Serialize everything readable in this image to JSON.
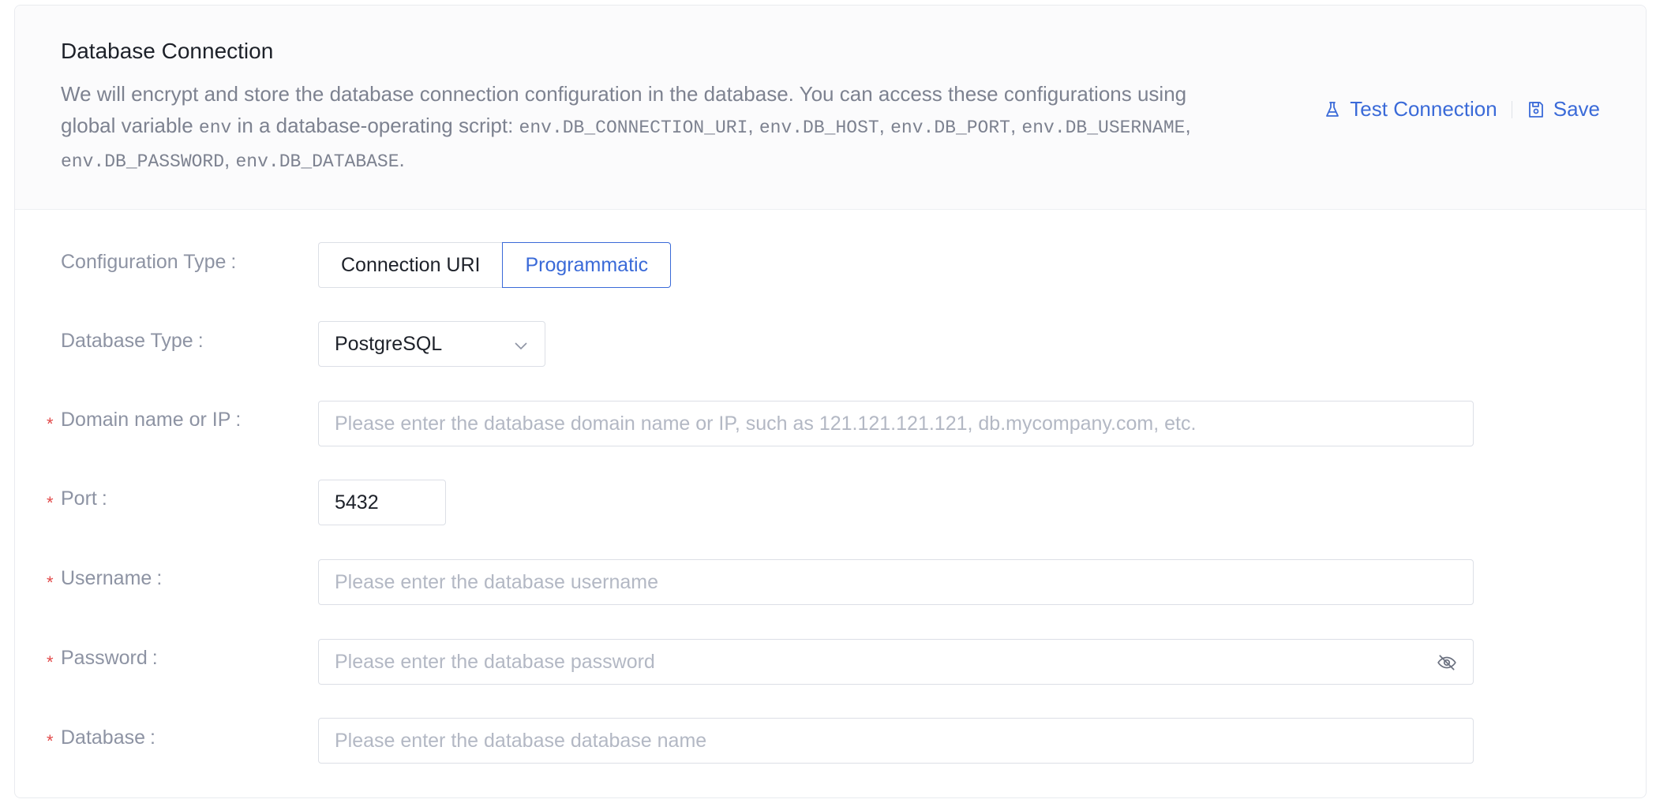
{
  "header": {
    "title": "Database Connection",
    "desc_text_1": "We will encrypt and store the database connection configuration in the database. You can access these configurations using global variable ",
    "desc_code_env": "env",
    "desc_text_2": " in a database-operating script: ",
    "desc_code_1": "env.DB_CONNECTION_URI",
    "desc_code_2": "env.DB_HOST",
    "desc_code_3": "env.DB_PORT",
    "desc_code_4": "env.DB_USERNAME",
    "desc_code_5": "env.DB_PASSWORD",
    "desc_code_6": "env.DB_DATABASE",
    "sep": ", ",
    "end": "."
  },
  "actions": {
    "test_label": "Test Connection",
    "test_icon": "flask-icon",
    "save_label": "Save",
    "save_icon": "save-icon"
  },
  "form": {
    "config_type_label": "Configuration Type",
    "config_type_options": [
      "Connection URI",
      "Programmatic"
    ],
    "config_type_selected": "Programmatic",
    "db_type_label": "Database Type",
    "db_type_value": "PostgreSQL",
    "domain_label": "Domain name or IP",
    "domain_placeholder": "Please enter the database domain name or IP, such as 121.121.121.121, db.mycompany.com, etc.",
    "port_label": "Port",
    "port_value": "5432",
    "username_label": "Username",
    "username_placeholder": "Please enter the database username",
    "password_label": "Password",
    "password_placeholder": "Please enter the database password",
    "database_label": "Database",
    "database_placeholder": "Please enter the database database name",
    "colon": ":",
    "required_mark": "*"
  },
  "colors": {
    "accent": "#3a6ad8",
    "required": "#e24a4a",
    "label": "#8d93a3"
  }
}
